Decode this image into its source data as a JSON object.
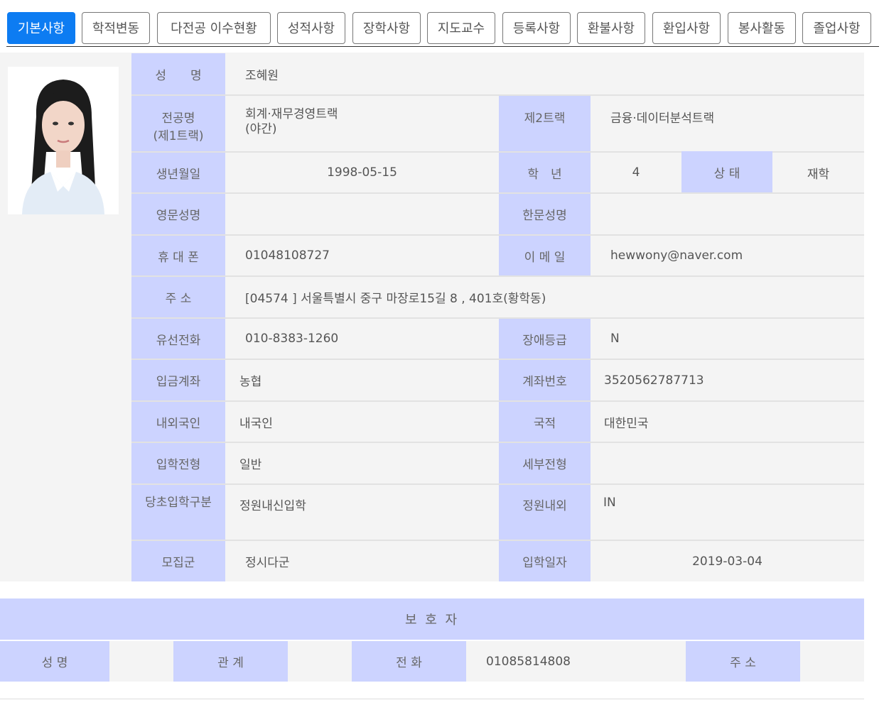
{
  "tabs": [
    {
      "label": "기본사항",
      "active": true
    },
    {
      "label": "학적변동"
    },
    {
      "label": "다전공 이수현황"
    },
    {
      "label": "성적사항"
    },
    {
      "label": "장학사항"
    },
    {
      "label": "지도교수"
    },
    {
      "label": "등록사항"
    },
    {
      "label": "환불사항"
    },
    {
      "label": "환입사항"
    },
    {
      "label": "봉사활동"
    },
    {
      "label": "졸업사항"
    }
  ],
  "student": {
    "name_label": "성　　명",
    "name": "조혜원",
    "major_label": "전공명\n(제1트랙)",
    "major": "회계·재무경영트랙\n(야간)",
    "track2_label": "제2트랙",
    "track2": "금융·데이터분석트랙",
    "birth_label": "생년월일",
    "birth": "1998-05-15",
    "year_label": "학　년",
    "year": "4",
    "status_label": "상 태",
    "status": "재학",
    "eng_name_label": "영문성명",
    "eng_name": "",
    "hanja_name_label": "한문성명",
    "hanja_name": "",
    "mobile_label": "휴 대 폰",
    "mobile": "01048108727",
    "email_label": "이 메 일",
    "email": "hewwony@naver.com",
    "address_label": "주 소",
    "address": "[04574 ] 서울특별시 중구 마장로15길 8 , 401호(황학동)",
    "phone_label": "유선전화",
    "phone": "010-8383-1260",
    "disability_label": "장애등급",
    "disability": "N",
    "bank_label": "입금계좌",
    "bank": "농협",
    "account_label": "계좌번호",
    "account": "3520562787713",
    "nationality_type_label": "내외국인",
    "nationality_type": "내국인",
    "country_label": "국적",
    "country": "대한민국",
    "admission_type_label": "입학전형",
    "admission_type": "일반",
    "admission_detail_label": "세부전형",
    "admission_detail": "",
    "initial_admission_label": "당초입학구분",
    "initial_admission": "정원내신입학",
    "quota_label": "정원내외",
    "quota": "IN",
    "group_label": "모집군",
    "group": "정시다군",
    "admission_date_label": "입학일자",
    "admission_date": "2019-03-04"
  },
  "guardian": {
    "title": "보 호 자",
    "name_label": "성 명",
    "name": "",
    "relation_label": "관 계",
    "relation": "",
    "phone_label": "전 화",
    "phone": "01085814808",
    "address_label": "주 소",
    "address": ""
  },
  "colors": {
    "accent": "#0d7cf2",
    "label_bg": "#ccd3ff",
    "panel_bg": "#f4f4f4"
  }
}
